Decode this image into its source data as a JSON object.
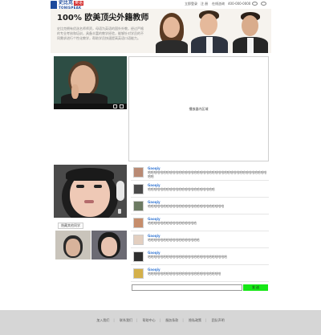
{
  "brand": {
    "logo_cn": "史比克",
    "logo_tag": "英语",
    "logo_en": "TONISPEAK"
  },
  "topnav": {
    "links": [
      "立即登录",
      "注 册",
      "在线咨询",
      "400-000-0000"
    ]
  },
  "banner": {
    "title": "100% 欧美顶尖外籍教师",
    "description": "史比克拥有优选名师师资，母语为英语的国外外教，经过严格的专业考核和培训，具备丰富的教学经验，能够针对学员的不同需求进行个性化教学，帮助学员快速提高英语口语能力。"
  },
  "whiteboard": {
    "label": "播放器内区域"
  },
  "video_controls": {
    "volume_icon": "speaker-icon",
    "fullscreen_icon": "fullscreen-icon"
  },
  "student_panel": {
    "hide_button": "隐藏其他同学"
  },
  "chat": {
    "messages": [
      {
        "user": "Gaoqiy",
        "text": "哈哈哈哈哈哈哈哈哈哈哈哈哈哈哈哈哈哈哈哈哈哈哈哈哈哈哈哈哈哈哈哈哈哈哈哈哈哈哈哈哈"
      },
      {
        "user": "Gaoqiy",
        "text": "哈哈哈哈哈哈哈哈哈哈哈哈哈哈哈哈哈哈哈哈哈哈"
      },
      {
        "user": "Gaoqiy",
        "text": "哈哈哈哈哈哈哈哈哈哈哈哈哈哈哈哈哈哈哈哈哈哈哈哈哈"
      },
      {
        "user": "Gaoqiy",
        "text": "哈哈哈哈哈哈哈哈哈哈哈哈哈哈哈哈"
      },
      {
        "user": "Gaoqiy",
        "text": "哈哈哈哈哈哈哈哈哈哈哈哈哈哈哈哈哈"
      },
      {
        "user": "Gaoqiy",
        "text": "哈哈哈哈哈哈哈哈哈哈哈哈哈哈哈哈哈哈哈哈哈哈哈哈哈哈"
      },
      {
        "user": "Gaoqiy",
        "text": "哈哈哈哈哈哈哈哈哈哈哈哈哈哈哈哈哈哈哈哈哈哈哈哈"
      }
    ],
    "send_label": "发 送"
  },
  "footer": {
    "links": [
      "加入我们",
      "联系我们",
      "帮助中心",
      "服务条款",
      "隐私政策",
      "团队声明"
    ]
  },
  "colors": {
    "brand_blue": "#1d4a9c",
    "accent_red": "#d42a2a",
    "username_blue": "#3a7bd5",
    "send_green": "#16e716"
  }
}
